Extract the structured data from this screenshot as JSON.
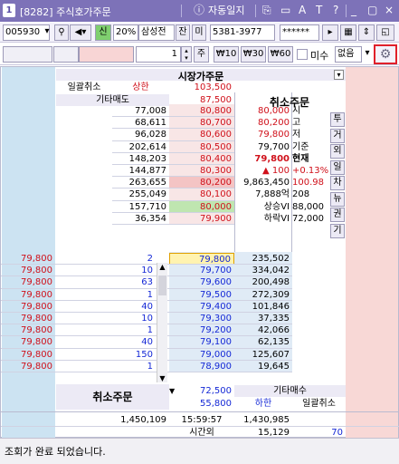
{
  "window": {
    "num": "1",
    "title": "[8282] 주식호가주문",
    "toolbar": [
      "ⓘ",
      "자동일지",
      "⎘",
      "▭",
      "A",
      "T",
      "?",
      "_",
      "▢",
      "×"
    ]
  },
  "toolbar1": {
    "code": "005930",
    "market_btn": "신",
    "margin": "20%",
    "name": "삼성전",
    "tag1": "잔",
    "tag2": "미",
    "account": "5381-3977",
    "password": "******"
  },
  "toolbar2": {
    "qty": "1",
    "unit": "주",
    "b1": "₩10",
    "b2": "₩30",
    "b3": "₩60",
    "chk_label": "미수",
    "select_value": "없음"
  },
  "header": {
    "market_order": "시장가주문",
    "bulk_cancel": "일괄취소",
    "upper_label": "상한",
    "upper_price": "103,500",
    "other_sell": "기타매도",
    "other_sell_price": "87,500",
    "cancel_order": "취소주문"
  },
  "asks": [
    {
      "qty": "77,008",
      "price": "80,800"
    },
    {
      "qty": "68,611",
      "price": "80,700"
    },
    {
      "qty": "96,028",
      "price": "80,600"
    },
    {
      "qty": "202,614",
      "price": "80,500"
    },
    {
      "qty": "148,203",
      "price": "80,400"
    },
    {
      "qty": "144,877",
      "price": "80,300"
    },
    {
      "qty": "263,655",
      "price": "80,200"
    },
    {
      "qty": "255,049",
      "price": "80,100"
    },
    {
      "qty": "157,710",
      "price": "80,000"
    },
    {
      "qty": "36,354",
      "price": "79,900"
    }
  ],
  "info": [
    {
      "label": "시",
      "value": "80,000"
    },
    {
      "label": "고",
      "value": "80,200"
    },
    {
      "label": "저",
      "value": "79,800"
    },
    {
      "label": "기준",
      "value": "79,700"
    },
    {
      "label": "현재",
      "value": "79,800"
    },
    {
      "label": "+0.13%",
      "value": "▲   100"
    },
    {
      "label": "100.98",
      "value": "9,863,450"
    },
    {
      "label": "208",
      "value": "7,888억"
    },
    {
      "label": "88,000",
      "value": "상승VI"
    },
    {
      "label": "72,000",
      "value": "하락VI"
    }
  ],
  "side_tabs": [
    "투",
    "거",
    "외",
    "일",
    "차",
    "뉴",
    "권",
    "기"
  ],
  "bids": [
    {
      "order": "79,800",
      "n": "2",
      "price": "79,800",
      "qty": "235,502"
    },
    {
      "order": "79,800",
      "n": "10",
      "price": "79,700",
      "qty": "334,042"
    },
    {
      "order": "79,800",
      "n": "63",
      "price": "79,600",
      "qty": "200,498"
    },
    {
      "order": "79,800",
      "n": "1",
      "price": "79,500",
      "qty": "272,309"
    },
    {
      "order": "79,800",
      "n": "40",
      "price": "79,400",
      "qty": "101,846"
    },
    {
      "order": "79,800",
      "n": "10",
      "price": "79,300",
      "qty": "37,335"
    },
    {
      "order": "79,800",
      "n": "1",
      "price": "79,200",
      "qty": "42,066"
    },
    {
      "order": "79,800",
      "n": "40",
      "price": "79,100",
      "qty": "62,135"
    },
    {
      "order": "79,800",
      "n": "150",
      "price": "79,000",
      "qty": "125,607"
    },
    {
      "order": "79,800",
      "n": "1",
      "price": "78,900",
      "qty": "19,645"
    }
  ],
  "footer": {
    "cancel_order": "취소주문",
    "other_buy_price": "72,500",
    "other_buy": "기타매수",
    "lower_price": "55,800",
    "lower_label": "하한",
    "bulk_cancel": "일괄취소",
    "total_ask": "1,450,109",
    "time": "15:59:57",
    "total_bid": "1,430,985",
    "after_label": "시간외",
    "after_qty": "15,129",
    "after_small": "70"
  },
  "status": "조회가 완료 되었습니다."
}
